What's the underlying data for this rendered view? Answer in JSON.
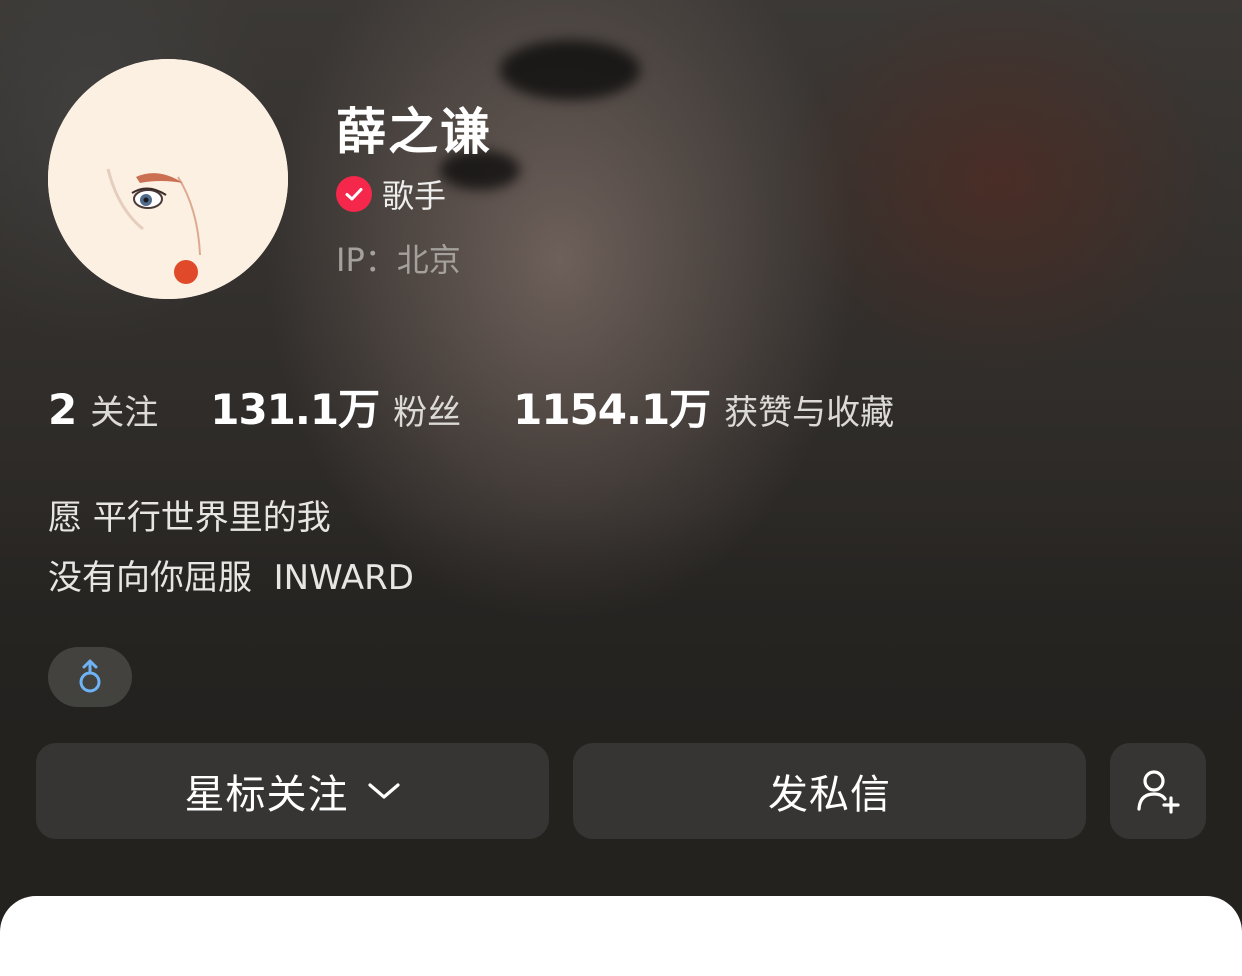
{
  "profile": {
    "name": "薛之谦",
    "role": "歌手",
    "ip": "IP：北京"
  },
  "stats": [
    {
      "value": "2",
      "label": "关注"
    },
    {
      "value": "131.1万",
      "label": "粉丝"
    },
    {
      "value": "1154.1万",
      "label": "获赞与收藏"
    }
  ],
  "bio": {
    "line1": "愿 平行世界里的我",
    "line2": "没有向你屈服  INWARD"
  },
  "gender_icon": "male-symbol-icon",
  "actions": {
    "star_follow": "星标关注",
    "message": "发私信",
    "add_friend_icon": "person-add-icon"
  },
  "colors": {
    "verified": "#f5284b",
    "gender": "#6fb3f5"
  }
}
